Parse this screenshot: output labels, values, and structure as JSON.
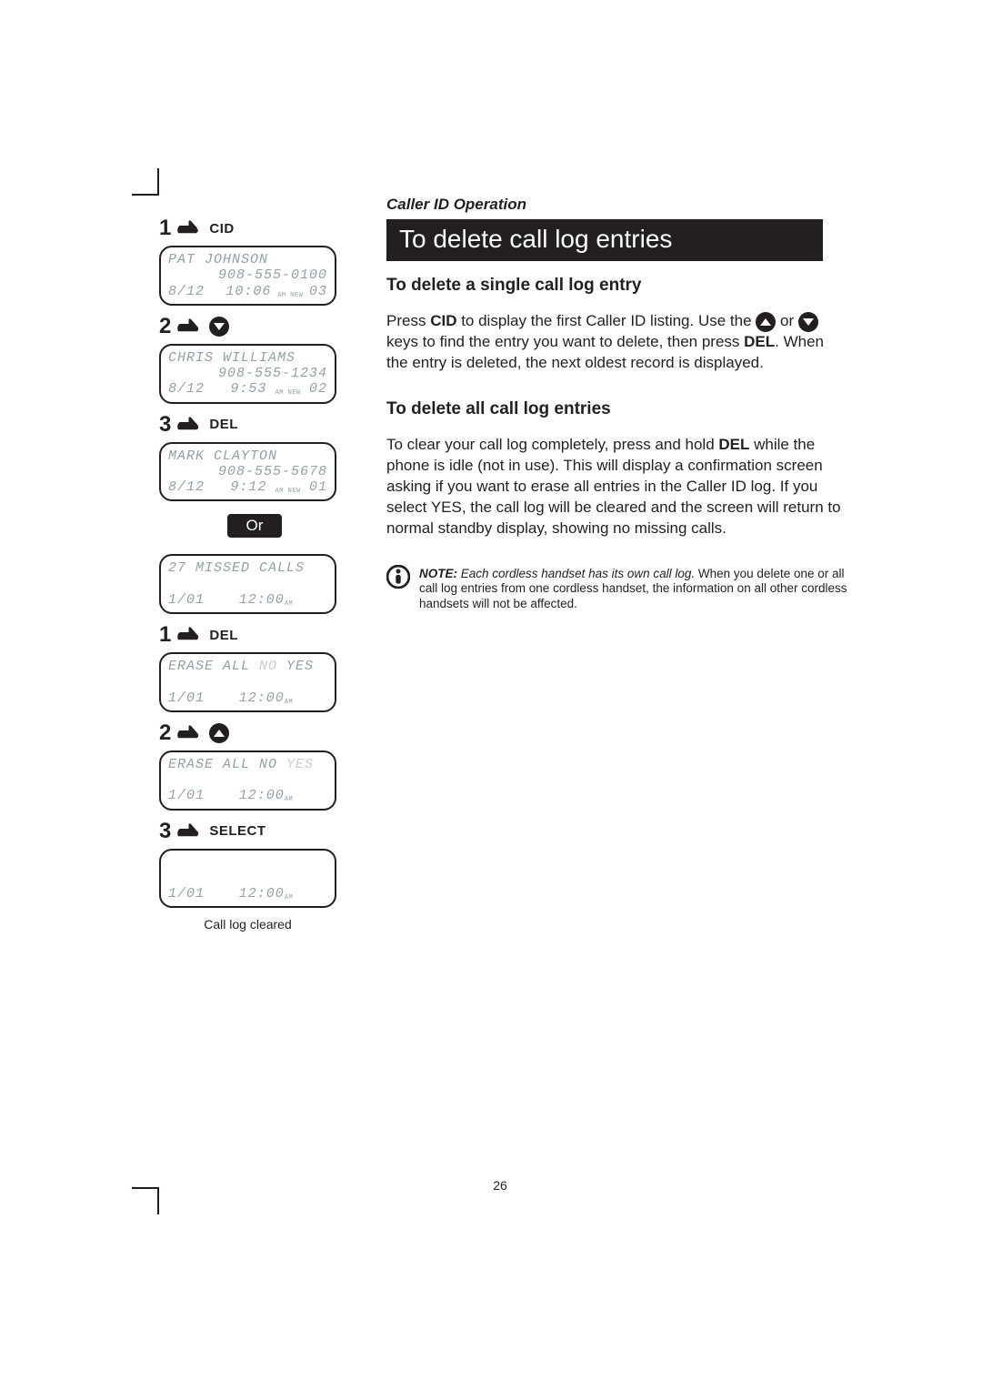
{
  "section_header": "Caller ID Operation",
  "title": "To delete call log entries",
  "sub1": "To delete a single call log entry",
  "para1_a": "Press ",
  "para1_cid": "CID",
  "para1_b": " to display the first Caller ID listing. Use the ",
  "para1_c": " or ",
  "para1_d": " keys to find the entry you want to delete, then press ",
  "para1_del": "DEL",
  "para1_e": ".  When the entry is deleted, the next oldest record is displayed.",
  "sub2": "To delete all call log entries",
  "para2_a": "To clear your call log completely, press and hold ",
  "para2_del": "DEL",
  "para2_b": " while the phone is idle (not in use).  This will display a confirmation screen asking if you want to erase all entries in the Caller ID log. If you select YES, the call log will be cleared and the screen will return to normal standby display, showing no missing calls.",
  "note_bold": "NOTE:",
  "note_italic": " Each cordless handset has its own call log.",
  "note_rest": " When you delete one or all call log entries from one cordless handset, the information on all other cordless handsets will not be affected.",
  "steps_a": [
    {
      "num": "1",
      "label": "CID"
    },
    {
      "num": "2",
      "label": ""
    },
    {
      "num": "3",
      "label": "DEL"
    }
  ],
  "steps_b": [
    {
      "num": "1",
      "label": "DEL"
    },
    {
      "num": "2",
      "label": ""
    },
    {
      "num": "3",
      "label": "SELECT"
    }
  ],
  "or_label": "Or",
  "lcd": [
    {
      "l1": "PAT JOHNSON",
      "l2": "908-555-0100",
      "date": "8/12",
      "time": "10:06",
      "sup": "AM NEW",
      "seq": "03"
    },
    {
      "l1": "CHRIS WILLIAMS",
      "l2": "908-555-1234",
      "date": "8/12",
      "time": "9:53",
      "sup": "AM NEW",
      "seq": "02"
    },
    {
      "l1": "MARK CLAYTON",
      "l2": "908-555-5678",
      "date": "8/12",
      "time": "9:12",
      "sup": "AM NEW",
      "seq": "01"
    }
  ],
  "lcd_misc": [
    {
      "l1": "27 MISSED CALLS",
      "date": "1/01",
      "time": "12:00",
      "sup": "AM"
    },
    {
      "l1": "ERASE ALL NO YES",
      "hl": "YES",
      "date": "1/01",
      "time": "12:00",
      "sup": "AM"
    },
    {
      "l1": "ERASE ALL NO YES",
      "hl": "NO",
      "date": "1/01",
      "time": "12:00",
      "sup": "AM"
    },
    {
      "l1": "",
      "date": "1/01",
      "time": "12:00",
      "sup": "AM"
    }
  ],
  "caption": "Call log cleared",
  "page_number": "26"
}
